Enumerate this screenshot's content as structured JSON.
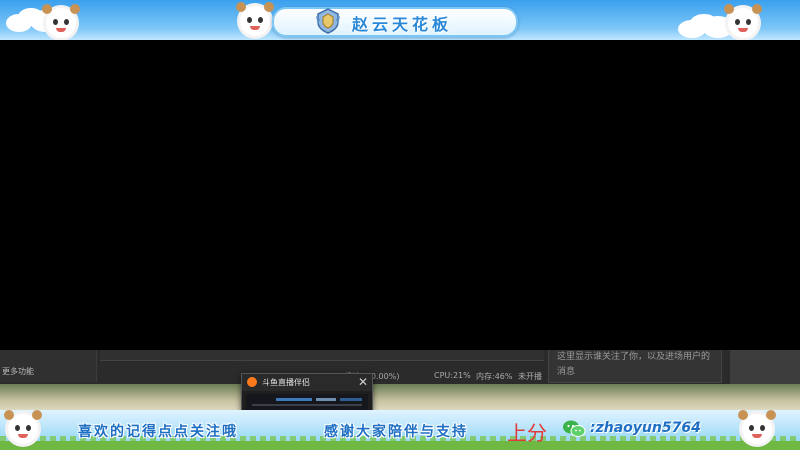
{
  "banner": {
    "title": "赵云天花板",
    "rank_icon": "rank-badge-icon",
    "accent": "#2a88d8"
  },
  "desktop": {
    "more_features": "更多功能",
    "notice": "这里显示谁关注了你，以及进场用户的消息",
    "status": {
      "dropped_frames": "丢帧:0(0.00%)",
      "cpu": "CPU:21%",
      "memory": "内存:46%",
      "stream_state": "未开播"
    }
  },
  "popup": {
    "title": "斗鱼直播伴侣",
    "close_icon": "close-icon"
  },
  "footer": {
    "follow_text": "喜欢的记得点点关注哦",
    "thanks_text": "感谢大家陪伴与支持",
    "rank_up": "上分",
    "wechat_icon": "wechat-icon",
    "wechat_sep": ":",
    "wechat_id": "zhaoyun5764",
    "text_color": "#1e6fc4",
    "highlight_color": "#e23a3a"
  }
}
